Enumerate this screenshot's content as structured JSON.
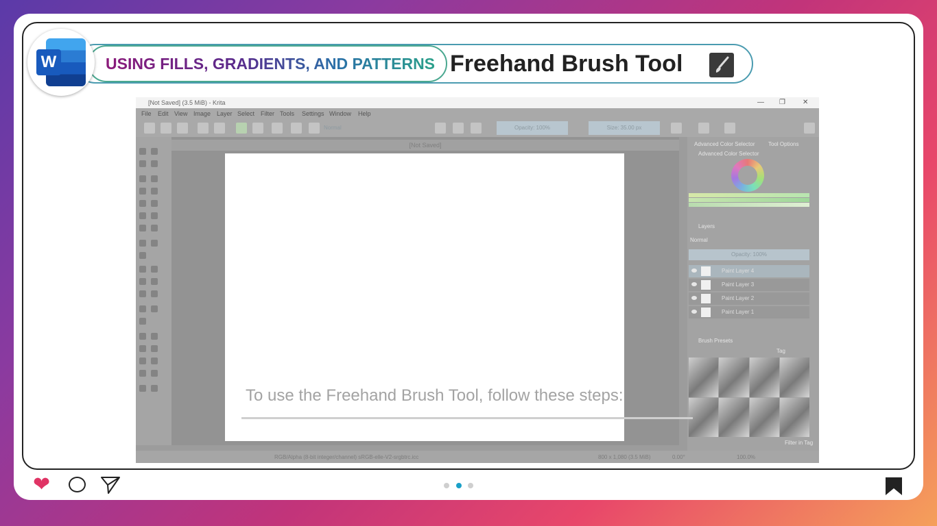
{
  "header": {
    "subtitle": "USING FILLS, GRADIENTS, AND PATTERNS",
    "title": "Freehand Brush Tool",
    "logo_letter": "W",
    "logo_icon": "word-app-icon",
    "title_icon": "brush-icon"
  },
  "krita": {
    "window_title": "[Not Saved]  (3.5 MiB)  - Krita",
    "menu": [
      "File",
      "Edit",
      "View",
      "Image",
      "Layer",
      "Select",
      "Filter",
      "Tools",
      "Settings",
      "Window",
      "Help"
    ],
    "preset_name": "Normal",
    "opacity": "Opacity: 100%",
    "size": "Size: 35.00 px",
    "doc_tab": "[Not Saved]",
    "dockers": {
      "tabs": [
        "Advanced Color Selector",
        "Tool Options"
      ],
      "color_selector": "Advanced Color Selector",
      "layers": "Layers",
      "blend_mode": "Normal",
      "layer_opacity": "Opacity: 100%",
      "layer_names": [
        "Paint Layer 4",
        "Paint Layer 3",
        "Paint Layer 2",
        "Paint Layer 1"
      ],
      "brush_presets": "Brush Presets",
      "tag_label": "Tag",
      "filter_label": "Filter in Tag"
    },
    "status": {
      "color_space": "RGB/Alpha (8-bit integer/channel)  sRGB-elle-V2-srgbtrc.icc",
      "dimensions": "800 x 1,080 (3.5 MiB)",
      "rotation": "0.00°",
      "zoom": "100.0%"
    }
  },
  "caption": "To use the Freehand Brush Tool, follow these steps:",
  "footer": {
    "like_icon": "heart-icon",
    "comment_icon": "comment-icon",
    "share_icon": "send-icon",
    "bookmark_icon": "bookmark-icon",
    "carousel_active_index": 1,
    "carousel_count": 3,
    "accent": "#e03465",
    "dot_active": "#1aa0c8"
  }
}
